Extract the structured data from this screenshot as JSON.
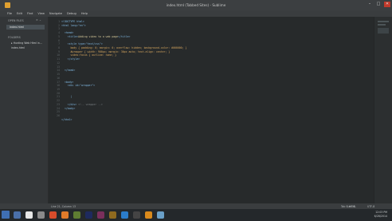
{
  "window": {
    "title": "index.html (Tabbed Sites) - Sublime",
    "controls": [
      "–",
      "□",
      "✕"
    ]
  },
  "menu": [
    "File",
    "Edit",
    "Find",
    "View",
    "Navigate",
    "Debug",
    "Help"
  ],
  "sidebar": {
    "open_files_label": "OPEN FILES",
    "close_label": "× ⌄",
    "open_file": "index.html",
    "folders_label": "FOLDERS",
    "folder": "▸ Hunting Web Html in...",
    "file": "index.html"
  },
  "editor": {
    "line_numbers": [
      "1",
      "2",
      "3",
      "4",
      "5",
      "6",
      "7",
      "8",
      "9",
      "10",
      "11",
      "12",
      "13",
      "14",
      "15",
      "16",
      "17",
      "18",
      "19",
      "20",
      "21",
      "22",
      "23",
      "24",
      "25",
      "26"
    ],
    "lines": [
      [
        {
          "t": "<!DOCTYPE html>",
          "c": "tag"
        }
      ],
      [
        {
          "t": "<html lang=\"en\">",
          "c": "tag"
        }
      ],
      [],
      [
        {
          "t": "  <head>",
          "c": "tag"
        }
      ],
      [
        {
          "t": "    <title>",
          "c": "tag"
        },
        {
          "t": "Adding video to a web page",
          "c": "txt"
        },
        {
          "t": "</title>",
          "c": "tag"
        }
      ],
      [],
      [
        {
          "t": "    <style type=\"text/css\">",
          "c": "tag"
        }
      ],
      [
        {
          "t": "      body { padding: 0; margin: 0; overflow: hidden; background-color: #000000; }",
          "c": "css"
        }
      ],
      [
        {
          "t": "      #wrapper { width: 900px; margin: 30px auto; text-align: center; }",
          "c": "css"
        }
      ],
      [
        {
          "t": "      video:focus { outline: none; }",
          "c": "css"
        }
      ],
      [
        {
          "t": "    </style>",
          "c": "tag"
        }
      ],
      [],
      [],
      [
        {
          "t": "  </head>",
          "c": "tag"
        }
      ],
      [],
      [],
      [
        {
          "t": "  <body>",
          "c": "tag"
        }
      ],
      [
        {
          "t": "    <div id=\"wrapper\">",
          "c": "tag"
        }
      ],
      [],
      [],
      [
        {
          "t": "      |",
          "c": "tag"
        }
      ],
      [],
      [
        {
          "t": "    </div> ",
          "c": "tag"
        },
        {
          "t": "<!-- wrapper -->",
          "c": "cm"
        }
      ],
      [
        {
          "t": "  </body>",
          "c": "tag"
        }
      ],
      [],
      [],
      [
        {
          "t": "</html>",
          "c": "tag"
        }
      ]
    ]
  },
  "statusbar": {
    "position": "Line 21, Column 13",
    "spaces": "Tab Size: 4",
    "syntax": "HTML",
    "encoding": "UTF-8"
  },
  "taskbar": {
    "clock_time": "12:03 PM",
    "clock_date": "6/28/2014"
  },
  "colors": {
    "accent": "#3f6fb3",
    "tag": "#7fb6df",
    "string_text": "#d5c89a",
    "css": "#d7a75f",
    "comment": "#757b7e"
  }
}
